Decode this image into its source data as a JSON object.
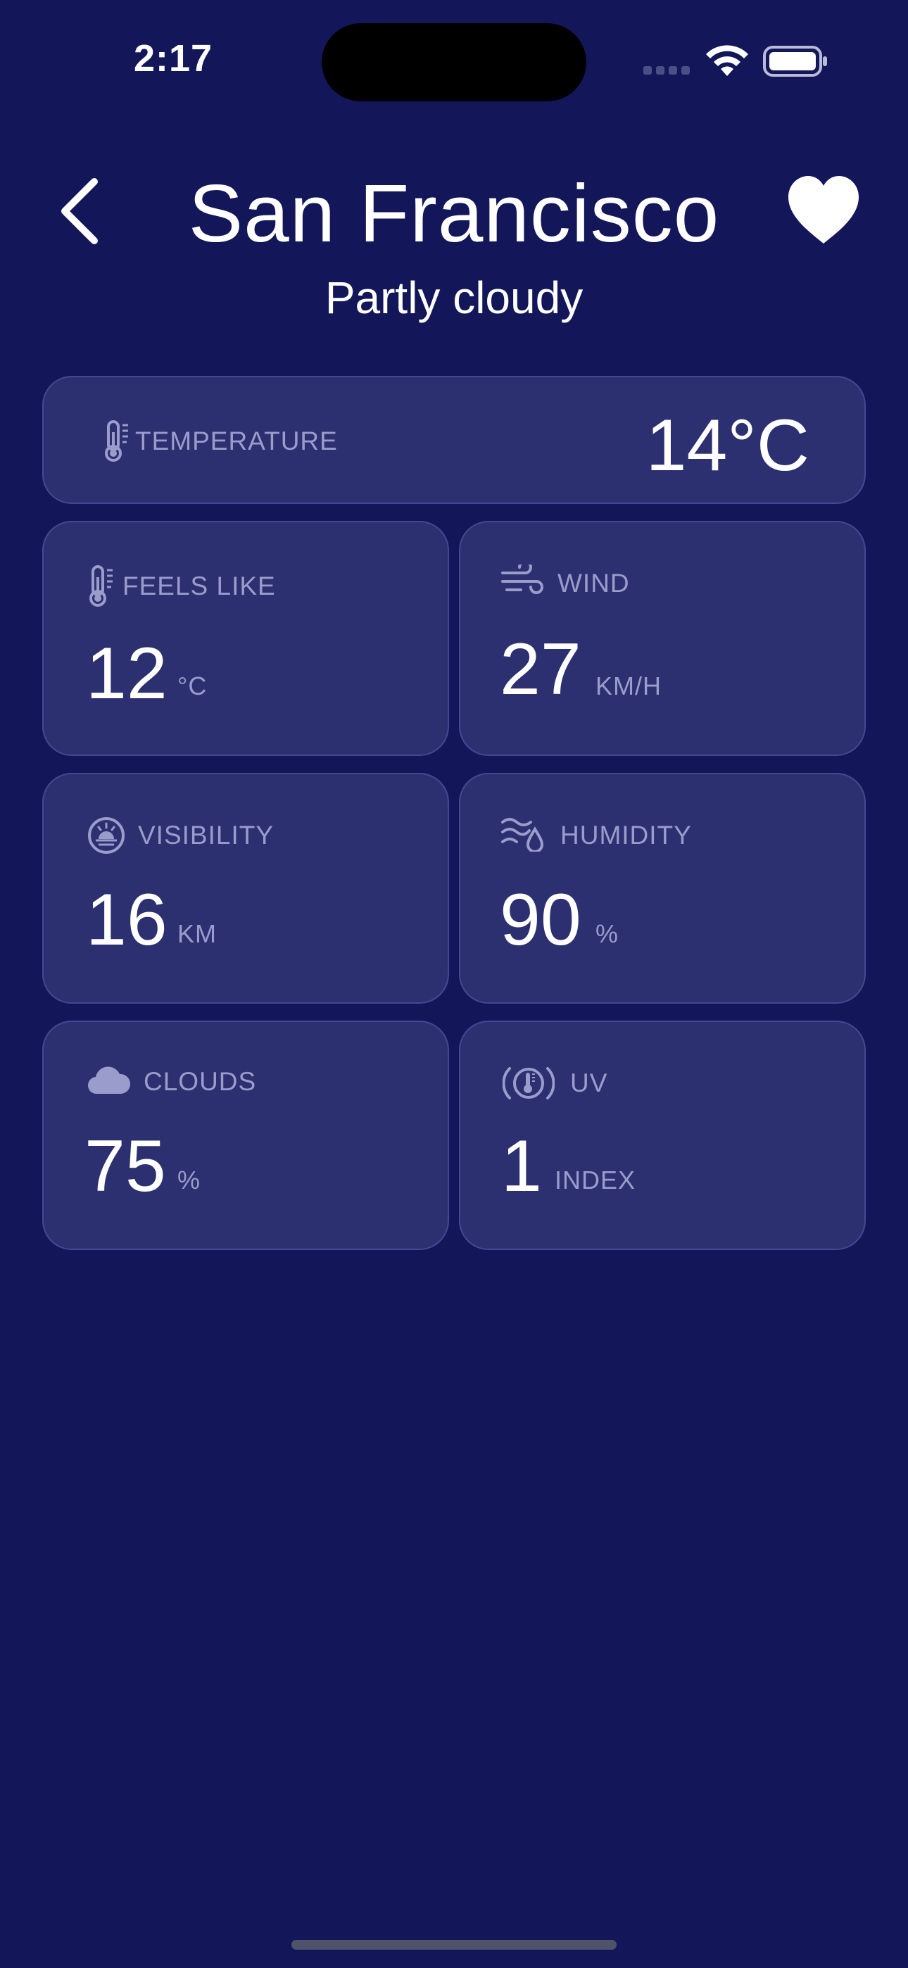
{
  "status_bar": {
    "time": "2:17",
    "icons": [
      "cellular-signal-icon",
      "wifi-icon",
      "battery-icon"
    ]
  },
  "header": {
    "city": "San Francisco",
    "condition": "Partly cloudy",
    "back_icon": "chevron-left-icon",
    "favorite_icon": "heart-icon"
  },
  "temperature": {
    "label": "TEMPERATURE",
    "value": "14°C",
    "icon": "thermometer-icon"
  },
  "metrics": {
    "feels_like": {
      "label": "FEELS LIKE",
      "value": "12",
      "unit": "°C",
      "icon": "thermometer-icon"
    },
    "wind": {
      "label": "WIND",
      "value": "27",
      "unit": "KM/H",
      "icon": "wind-icon"
    },
    "visibility": {
      "label": "VISIBILITY",
      "value": "16",
      "unit": "KM",
      "icon": "sun-horizon-icon"
    },
    "humidity": {
      "label": "HUMIDITY",
      "value": "90",
      "unit": "%",
      "icon": "humidity-icon"
    },
    "clouds": {
      "label": "CLOUDS",
      "value": "75",
      "unit": "%",
      "icon": "cloud-icon"
    },
    "uv": {
      "label": "UV",
      "value": "1",
      "unit": "INDEX",
      "icon": "uv-gauge-icon"
    }
  },
  "colors": {
    "background": "#13175a",
    "card": "#2d3070",
    "card_border": "#444894",
    "muted_text": "#9a9ccb",
    "text": "#ffffff"
  }
}
